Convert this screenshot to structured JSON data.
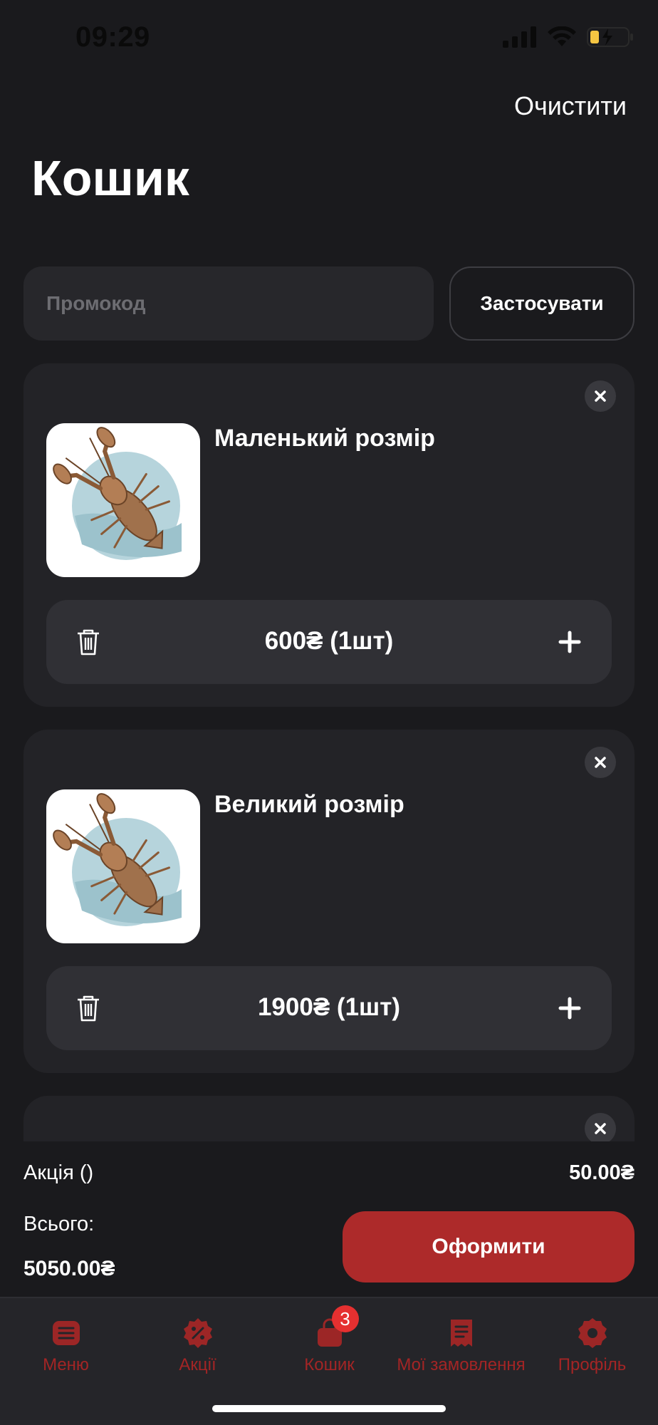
{
  "status": {
    "time": "09:29"
  },
  "header": {
    "clear_label": "Очистити",
    "title": "Кошик"
  },
  "promo": {
    "placeholder": "Промокод",
    "apply_label": "Застосувати"
  },
  "cart_items": [
    {
      "name": "Маленький розмір",
      "price": "600₴",
      "qty": "(1шт)"
    },
    {
      "name": "Великий розмір",
      "price": "1900₴",
      "qty": "(1шт)"
    }
  ],
  "summary": {
    "promo_label": "Акція ()",
    "promo_amount": "50.00₴",
    "total_label": "Всього:",
    "total_value": "5050.00₴",
    "checkout_label": "Оформити"
  },
  "tabs": [
    {
      "label": "Меню",
      "icon": "menu-icon"
    },
    {
      "label": "Акції",
      "icon": "discount-icon"
    },
    {
      "label": "Кошик",
      "icon": "cart-icon",
      "badge": "3"
    },
    {
      "label": "Мої замовлення",
      "icon": "orders-icon"
    },
    {
      "label": "Профіль",
      "icon": "profile-icon"
    }
  ],
  "colors": {
    "accent": "#ad2a2a",
    "tab_inactive": "#a32525",
    "badge": "#e53030"
  }
}
